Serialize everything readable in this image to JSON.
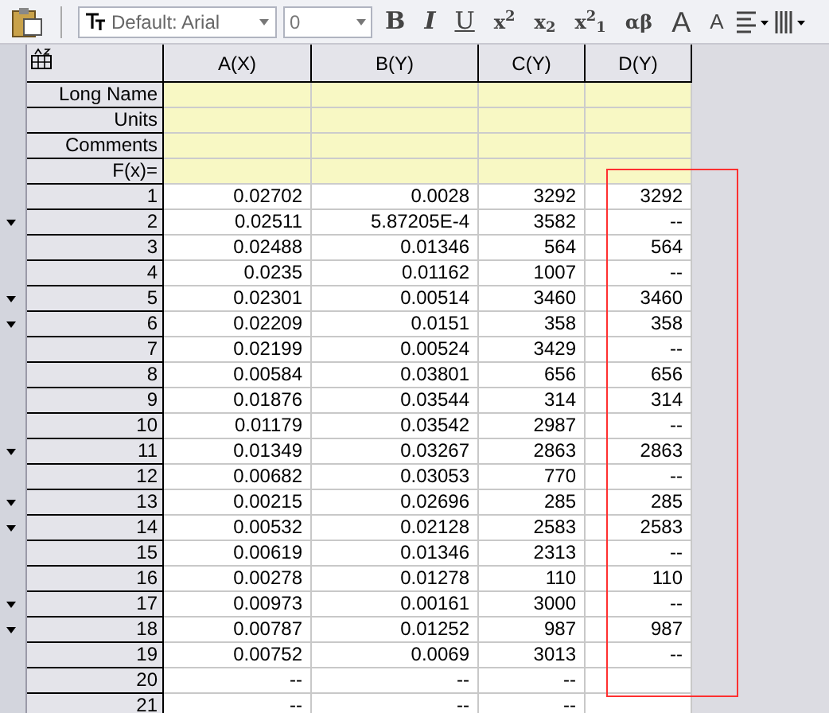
{
  "toolbar": {
    "font_family": "Default: Arial",
    "font_size": "0",
    "format_buttons": [
      {
        "kind": "bold",
        "label": "B"
      },
      {
        "kind": "italic",
        "label": "I"
      },
      {
        "kind": "underline",
        "label": "U"
      },
      {
        "kind": "plain",
        "label": "x$^{2}$"
      },
      {
        "kind": "plain",
        "label": "x$_{2}$"
      },
      {
        "kind": "plain",
        "label": "x$^{2}$$_{1}$"
      },
      {
        "kind": "plain",
        "label": "αβ"
      },
      {
        "kind": "grow",
        "label": "A"
      },
      {
        "kind": "shrink",
        "label": "A"
      }
    ]
  },
  "table": {
    "columns": [
      "A(X)",
      "B(Y)",
      "C(Y)",
      "D(Y)"
    ],
    "label_rows": [
      "Long Name",
      "Units",
      "Comments",
      "F(x)="
    ],
    "rows": [
      {
        "index": "1",
        "cells": [
          "0.02702",
          "0.0028",
          "3292",
          "3292"
        ]
      },
      {
        "index": "2",
        "cells": [
          "0.02511",
          "5.87205E-4",
          "3582",
          "--"
        ]
      },
      {
        "index": "3",
        "cells": [
          "0.02488",
          "0.01346",
          "564",
          "564"
        ]
      },
      {
        "index": "4",
        "cells": [
          "0.0235",
          "0.01162",
          "1007",
          "--"
        ]
      },
      {
        "index": "5",
        "cells": [
          "0.02301",
          "0.00514",
          "3460",
          "3460"
        ]
      },
      {
        "index": "6",
        "cells": [
          "0.02209",
          "0.0151",
          "358",
          "358"
        ]
      },
      {
        "index": "7",
        "cells": [
          "0.02199",
          "0.00524",
          "3429",
          "--"
        ]
      },
      {
        "index": "8",
        "cells": [
          "0.00584",
          "0.03801",
          "656",
          "656"
        ]
      },
      {
        "index": "9",
        "cells": [
          "0.01876",
          "0.03544",
          "314",
          "314"
        ]
      },
      {
        "index": "10",
        "cells": [
          "0.01179",
          "0.03542",
          "2987",
          "--"
        ]
      },
      {
        "index": "11",
        "cells": [
          "0.01349",
          "0.03267",
          "2863",
          "2863"
        ]
      },
      {
        "index": "12",
        "cells": [
          "0.00682",
          "0.03053",
          "770",
          "--"
        ]
      },
      {
        "index": "13",
        "cells": [
          "0.00215",
          "0.02696",
          "285",
          "285"
        ]
      },
      {
        "index": "14",
        "cells": [
          "0.00532",
          "0.02128",
          "2583",
          "2583"
        ]
      },
      {
        "index": "15",
        "cells": [
          "0.00619",
          "0.01346",
          "2313",
          "--"
        ]
      },
      {
        "index": "16",
        "cells": [
          "0.00278",
          "0.01278",
          "110",
          "110"
        ]
      },
      {
        "index": "17",
        "cells": [
          "0.00973",
          "0.00161",
          "3000",
          "--"
        ]
      },
      {
        "index": "18",
        "cells": [
          "0.00787",
          "0.01252",
          "987",
          "987"
        ]
      },
      {
        "index": "19",
        "cells": [
          "0.00752",
          "0.0069",
          "3013",
          "--"
        ]
      },
      {
        "index": "20",
        "cells": [
          "--",
          "--",
          "--"
        ]
      },
      {
        "index": "21",
        "cells": [
          "--",
          "--",
          "--"
        ]
      }
    ]
  }
}
